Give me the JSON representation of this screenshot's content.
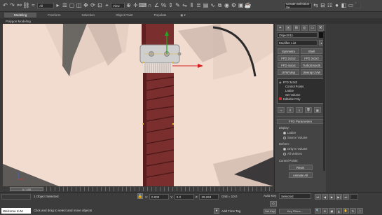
{
  "toolbar": {
    "filter_dropdown": "All",
    "view_dropdown": "View",
    "selection_set": "Create Selection Se"
  },
  "ribbon": {
    "tabs": [
      {
        "label": "Modeling",
        "active": true
      },
      {
        "label": "Freeform",
        "active": false
      },
      {
        "label": "Selection",
        "active": false
      },
      {
        "label": "Object Paint",
        "active": false
      },
      {
        "label": "Populate",
        "active": false
      }
    ],
    "sub_label": "Polygon Modeling"
  },
  "command_panel": {
    "object_name": "Object011",
    "modifier_list": "Modifier List",
    "modifier_buttons": [
      "Symmetry",
      "Shell",
      "FFD 2x2x2",
      "FFD 3x3x3",
      "FFD 4x4x4",
      "TurboSmooth",
      "UVW Map",
      "Unwrap UVW"
    ],
    "stack": {
      "items": [
        "FFD 3x3x3",
        "Control Points",
        "Lattice",
        "Set Volume",
        "Editable Poly"
      ]
    },
    "ffd_params": {
      "title": "FFD Parameters",
      "display_label": "Display:",
      "display_options": [
        "Lattice",
        "Source Volume"
      ],
      "deform_label": "Deform:",
      "deform_options": [
        "Only In Volume",
        "All Vertices"
      ],
      "control_points_label": "Control Points:",
      "reset_label": "Reset",
      "animate_all_label": "Animate All"
    }
  },
  "timeline": {
    "frame": "0 / 100"
  },
  "status": {
    "script_listener": "Welcome to M",
    "selection_info": "1 Object Selected",
    "prompt": "Click and drag to select and move objects",
    "x_label": "X:",
    "x_value": "0.000",
    "y_label": "Y:",
    "y_value": "0.0",
    "z_label": "Z:",
    "z_value": "29.263",
    "grid": "Grid = 10.0",
    "add_time_tag": "Add Time Tag",
    "auto_key": "Auto Key",
    "key_filter_dropdown": "Selected",
    "set_key": "Set Key",
    "key_filters": "Key Filters..."
  },
  "colors": {
    "viewport_bg": "#f2dcd0",
    "handle_red": "#7a2e2e",
    "accent_red": "#c0392b"
  }
}
